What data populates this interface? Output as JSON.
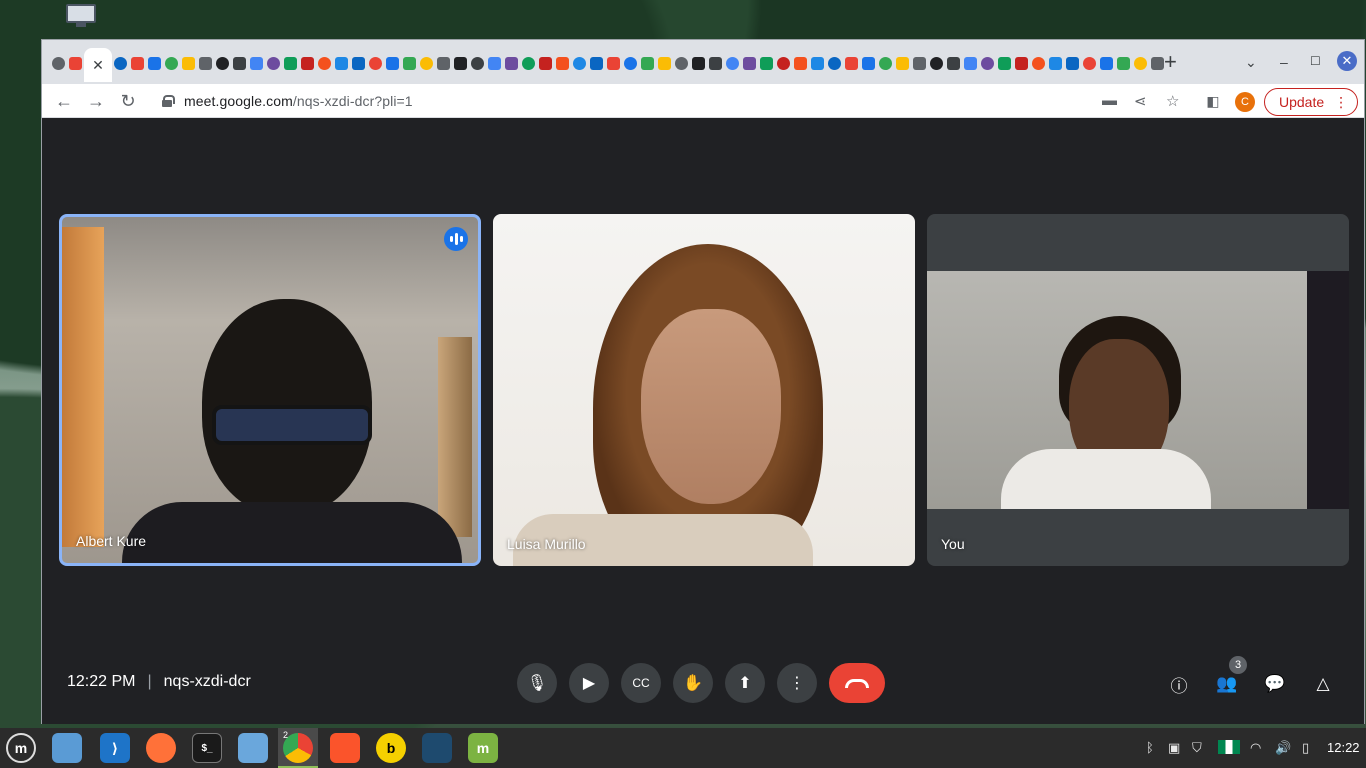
{
  "browser": {
    "active_tab_close": "✕",
    "new_tab": "+",
    "url_host": "meet.google.com",
    "url_path": "/nqs-xzdi-dcr?pli=1",
    "profile_initial": "C",
    "update_label": "Update"
  },
  "meet": {
    "participants": [
      {
        "name": "Albert Kure",
        "speaking": true
      },
      {
        "name": "Luisa Murillo",
        "speaking": false
      },
      {
        "name": "You",
        "speaking": false
      }
    ],
    "time": "12:22 PM",
    "separator": "|",
    "meeting_code": "nqs-xzdi-dcr",
    "participant_count": "3",
    "controls": [
      "mic-icon",
      "camera-icon",
      "captions-icon",
      "raise-hand-icon",
      "present-icon",
      "more-options-icon",
      "end-call-icon"
    ],
    "side_controls": [
      "info-icon",
      "people-icon",
      "chat-icon",
      "activities-icon"
    ]
  },
  "taskbar": {
    "chrome_window_count": "2",
    "clock": "12:22",
    "apps": [
      "mint-menu",
      "file-manager",
      "vscode",
      "firefox",
      "terminal",
      "files",
      "chrome",
      "brave",
      "bitwarden",
      "mysql-workbench",
      "mint-update"
    ]
  },
  "colors": {
    "accent": "#8ab4f8",
    "end_call": "#ea4335",
    "update": "#c5221f",
    "meet_bg": "#202124"
  }
}
